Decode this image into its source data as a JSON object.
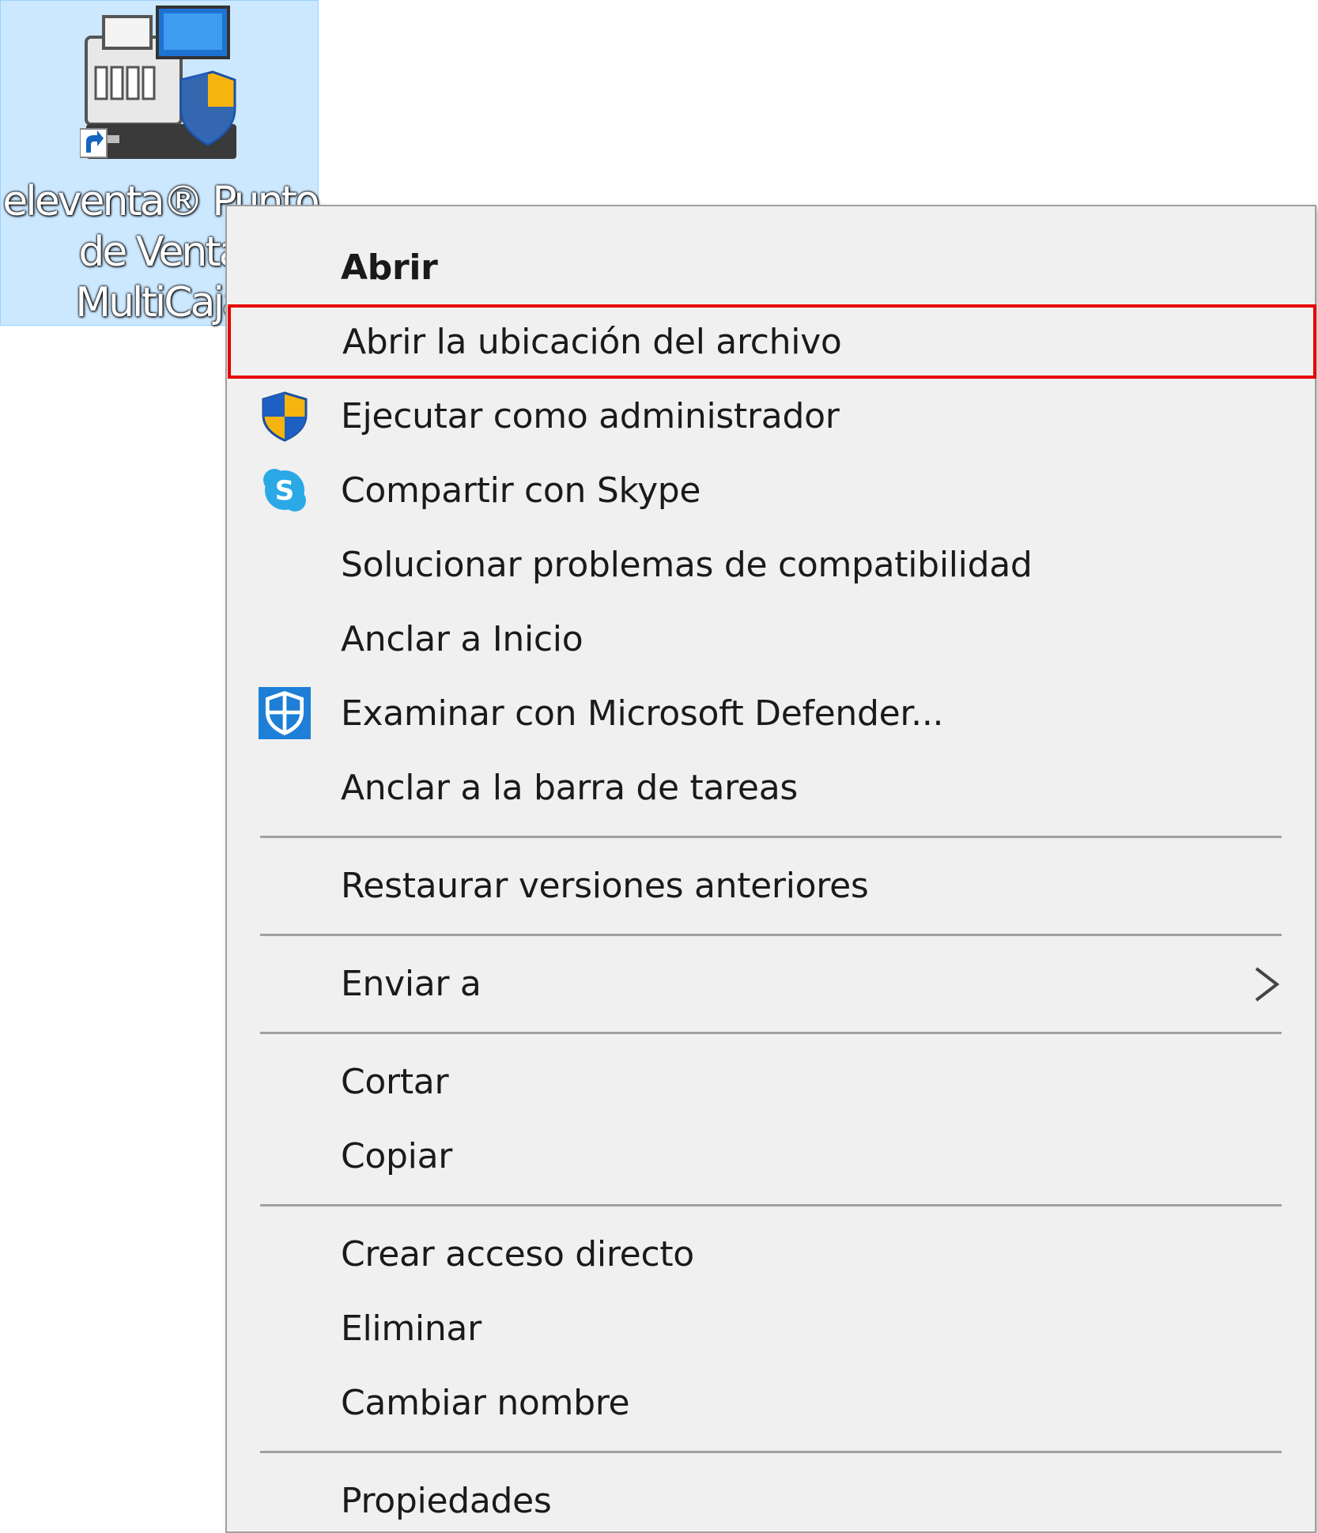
{
  "desktop_icon": {
    "label": "eleventa® Punto de Venta MultiCaja",
    "icon": "eleventa-pos-shortcut-icon"
  },
  "context_menu": {
    "items": [
      {
        "label": "Abrir",
        "bold": true,
        "icon": ""
      },
      {
        "label": "Abrir la ubicación del archivo",
        "highlighted": true,
        "icon": ""
      },
      {
        "label": "Ejecutar como administrador",
        "icon": "uac-shield-icon"
      },
      {
        "label": "Compartir con Skype",
        "icon": "skype-icon"
      },
      {
        "label": "Solucionar problemas de compatibilidad",
        "icon": ""
      },
      {
        "label": "Anclar a Inicio",
        "icon": ""
      },
      {
        "label": "Examinar con Microsoft Defender...",
        "icon": "defender-icon"
      },
      {
        "label": "Anclar a la barra de tareas",
        "icon": ""
      },
      {
        "label": "Restaurar versiones anteriores",
        "icon": ""
      },
      {
        "label": "Enviar a",
        "icon": "chevron-right-icon"
      },
      {
        "label": "Cortar",
        "icon": ""
      },
      {
        "label": "Copiar",
        "icon": ""
      },
      {
        "label": "Crear acceso directo",
        "icon": ""
      },
      {
        "label": "Eliminar",
        "icon": ""
      },
      {
        "label": "Cambiar nombre",
        "icon": ""
      },
      {
        "label": "Propiedades",
        "icon": ""
      }
    ]
  },
  "colors": {
    "menu_background": "#f0f0f0",
    "highlight_border": "#e60000",
    "selection_background": "#cce8ff",
    "separator": "#a0a0a0"
  }
}
